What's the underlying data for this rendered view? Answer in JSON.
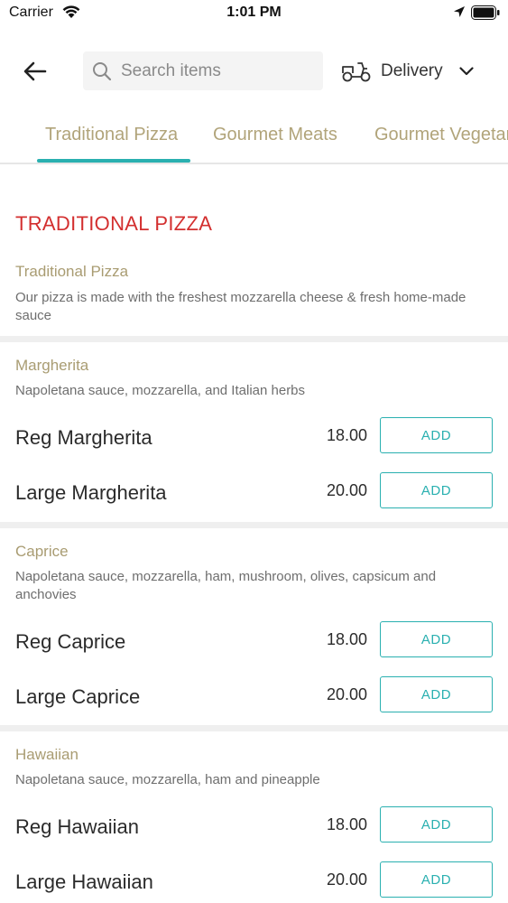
{
  "status_bar": {
    "carrier": "Carrier",
    "time": "1:01 PM"
  },
  "header": {
    "search_placeholder": "Search items",
    "delivery_label": "Delivery"
  },
  "tabs": [
    {
      "label": "Traditional Pizza",
      "active": true
    },
    {
      "label": "Gourmet Meats",
      "active": false
    },
    {
      "label": "Gourmet Vegetarian",
      "active": false
    }
  ],
  "section": {
    "title": "TRADITIONAL PIZZA",
    "intro_name": "Traditional Pizza",
    "intro_desc": "Our pizza is made with the freshest mozzarella cheese & fresh home-made sauce"
  },
  "categories": [
    {
      "name": "Margherita",
      "desc": "Napoletana sauce, mozzarella, and Italian herbs",
      "items": [
        {
          "name": "Reg Margherita",
          "price": "18.00",
          "button": "ADD"
        },
        {
          "name": "Large Margherita",
          "price": "20.00",
          "button": "ADD"
        }
      ]
    },
    {
      "name": "Caprice",
      "desc": "Napoletana sauce, mozzarella, ham, mushroom, olives, capsicum and anchovies",
      "items": [
        {
          "name": "Reg Caprice",
          "price": "18.00",
          "button": "ADD"
        },
        {
          "name": "Large Caprice",
          "price": "20.00",
          "button": "ADD"
        }
      ]
    },
    {
      "name": "Hawaiian",
      "desc": "Napoletana sauce, mozzarella, ham and pineapple",
      "items": [
        {
          "name": "Reg Hawaiian",
          "price": "18.00",
          "button": "ADD"
        },
        {
          "name": "Large Hawaiian",
          "price": "20.00",
          "button": "ADD"
        }
      ]
    }
  ],
  "colors": {
    "accent": "#2ab0b0",
    "section_title": "#d32f2f",
    "category_name": "#a99c72"
  },
  "icons": [
    "wifi-icon",
    "location-arrow-icon",
    "battery-icon",
    "back-arrow-icon",
    "search-icon",
    "scooter-icon",
    "chevron-down-icon"
  ]
}
